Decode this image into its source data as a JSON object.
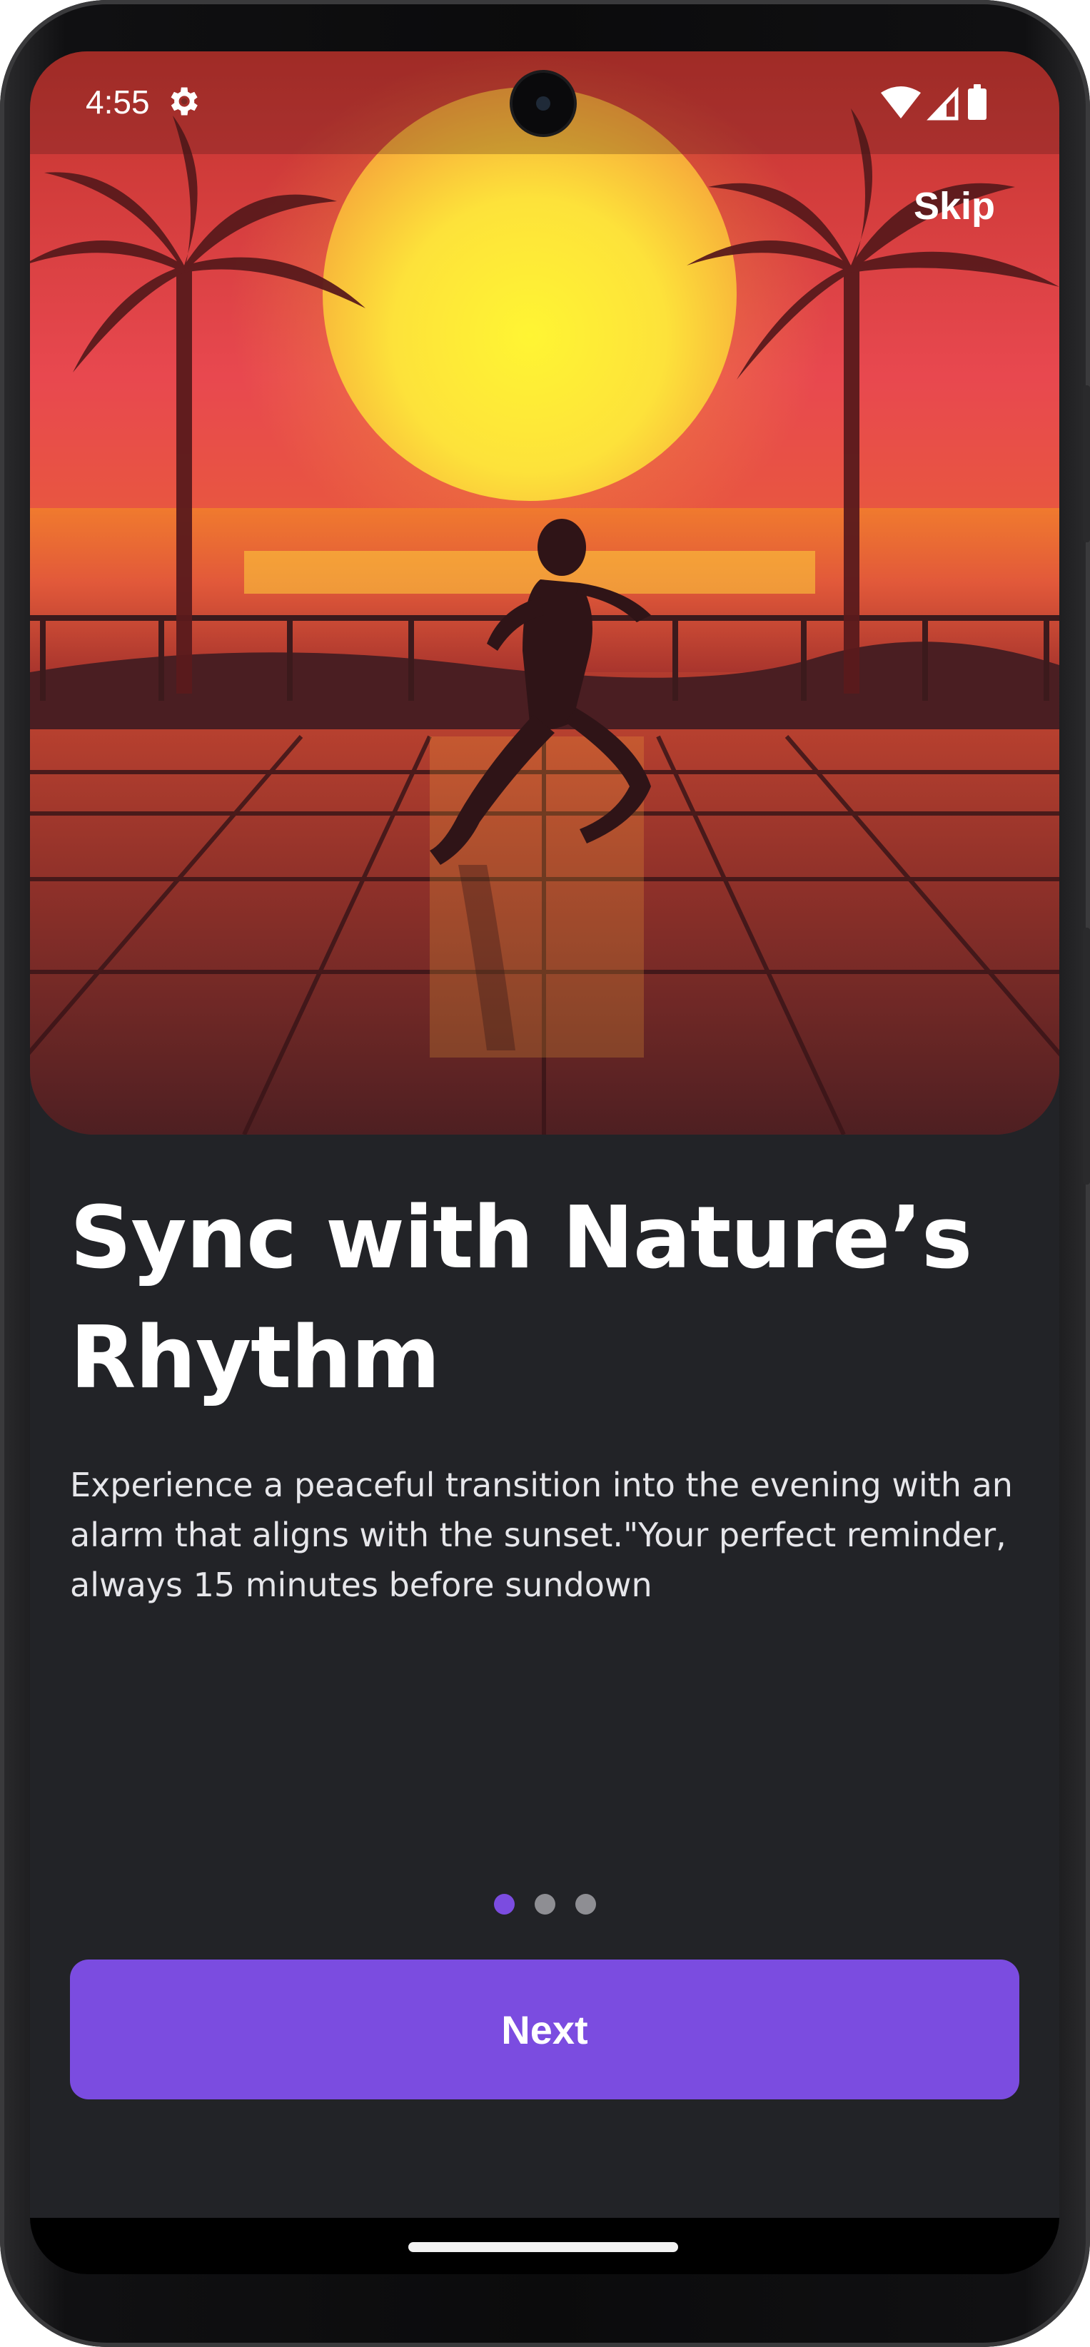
{
  "status_bar": {
    "time": "4:55",
    "icons": [
      "settings-gear-icon",
      "wifi-icon",
      "cellular-signal-icon",
      "battery-icon"
    ]
  },
  "hero": {
    "image_subject": "runner-silhouette-at-sunset",
    "skip_label": "Skip"
  },
  "onboarding": {
    "title_line1": "Sync with Nature’s",
    "title_line2": "Rhythm",
    "description": "Experience a peaceful transition into the evening with an alarm that aligns with the sunset.\"Your perfect reminder, always 15 minutes before sundown",
    "page_count": 3,
    "current_page": 1,
    "next_label": "Next"
  },
  "colors": {
    "background": "#222327",
    "accent": "#7b4ce0",
    "dot_inactive": "#8e8e93",
    "text_primary": "#ffffff"
  }
}
